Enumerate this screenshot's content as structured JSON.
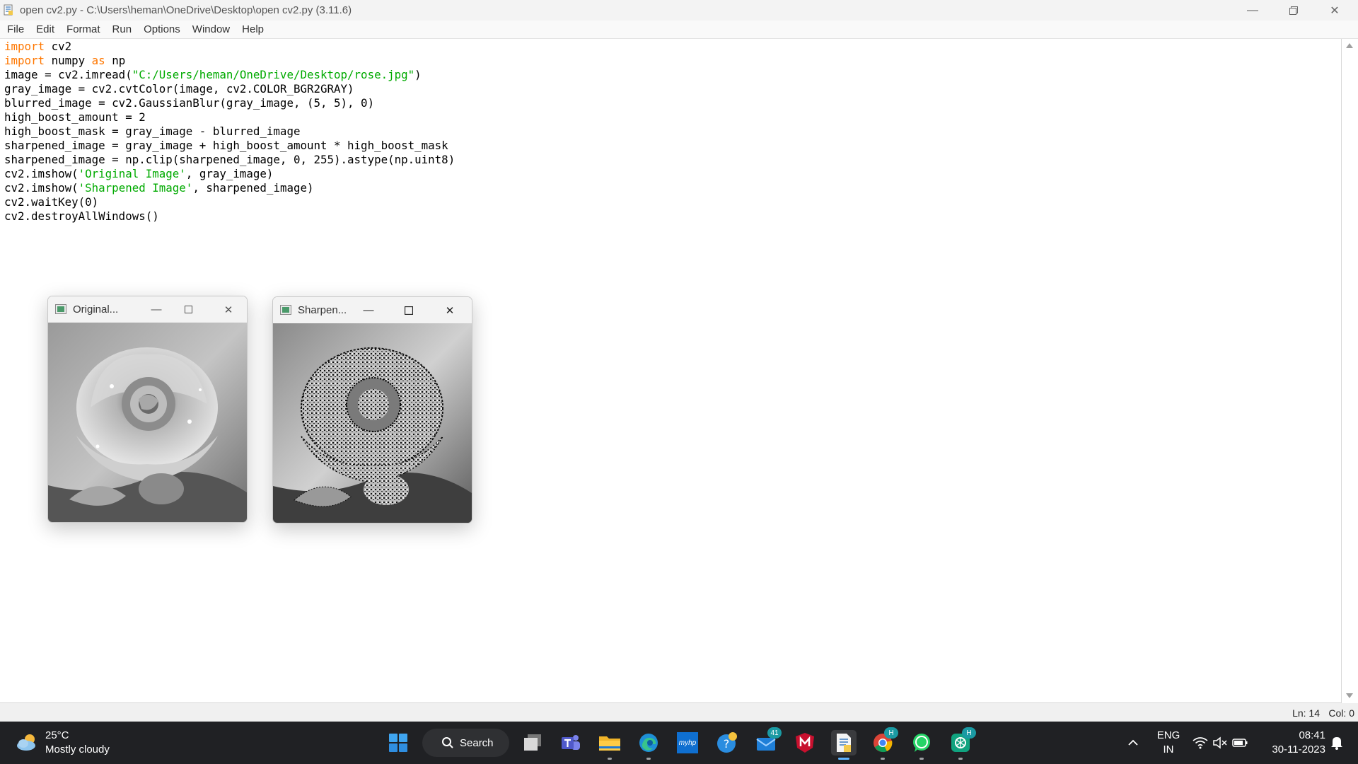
{
  "window": {
    "title": "open cv2.py - C:\\Users\\heman\\OneDrive\\Desktop\\open cv2.py (3.11.6)",
    "controls": [
      "minimize-icon",
      "restore-icon",
      "close-icon"
    ]
  },
  "menu": [
    "File",
    "Edit",
    "Format",
    "Run",
    "Options",
    "Window",
    "Help"
  ],
  "code": {
    "line1": {
      "kw": "import",
      "rest": " cv2"
    },
    "line2": {
      "kw1": "import",
      "mid": " numpy ",
      "kw2": "as",
      "rest": " np"
    },
    "line3": {
      "pre": "image = cv2.imread(",
      "str": "\"C:/Users/heman/OneDrive/Desktop/rose.jpg\"",
      "post": ")"
    },
    "line4": "gray_image = cv2.cvtColor(image, cv2.COLOR_BGR2GRAY)",
    "line5": "blurred_image = cv2.GaussianBlur(gray_image, (5, 5), 0)",
    "line6": "high_boost_amount = 2",
    "line7": "high_boost_mask = gray_image - blurred_image",
    "line8": "sharpened_image = gray_image + high_boost_amount * high_boost_mask",
    "line9": "sharpened_image = np.clip(sharpened_image, 0, 255).astype(np.uint8)",
    "line10": {
      "pre": "cv2.imshow(",
      "str": "'Original Image'",
      "post": ", gray_image)"
    },
    "line11": {
      "pre": "cv2.imshow(",
      "str": "'Sharpened Image'",
      "post": ", sharpened_image)"
    },
    "line12": "cv2.waitKey(0)",
    "line13": "cv2.destroyAllWindows()"
  },
  "status": {
    "line": "Ln: 14",
    "col": "Col: 0"
  },
  "image_windows": [
    {
      "title": "Original...",
      "content": "grayscale-rose-image"
    },
    {
      "title": "Sharpen...",
      "content": "sharpened-rose-image"
    }
  ],
  "taskbar": {
    "weather": {
      "temp": "25°C",
      "desc": "Mostly cloudy",
      "icon": "cloud-sun-icon"
    },
    "search_label": "Search",
    "apps": [
      {
        "name": "windows-start-icon"
      },
      {
        "name": "task-view-icon"
      },
      {
        "name": "teams-icon"
      },
      {
        "name": "file-explorer-icon"
      },
      {
        "name": "edge-icon"
      },
      {
        "name": "myhp-icon",
        "text": "myhp"
      },
      {
        "name": "get-help-icon"
      },
      {
        "name": "mail-icon",
        "badge": "41"
      },
      {
        "name": "mcafee-icon"
      },
      {
        "name": "idle-icon"
      },
      {
        "name": "chrome-icon",
        "badge": "H"
      },
      {
        "name": "whatsapp-icon"
      },
      {
        "name": "chatgpt-icon",
        "badge": "H"
      }
    ],
    "tray": {
      "lang1": "ENG",
      "lang2": "IN",
      "time": "08:41",
      "date": "30-11-2023"
    }
  },
  "colors": {
    "keyword": "#ff7700",
    "string": "#00aa00",
    "taskbar_bg": "#202124",
    "accent": "#1b9aa3"
  }
}
